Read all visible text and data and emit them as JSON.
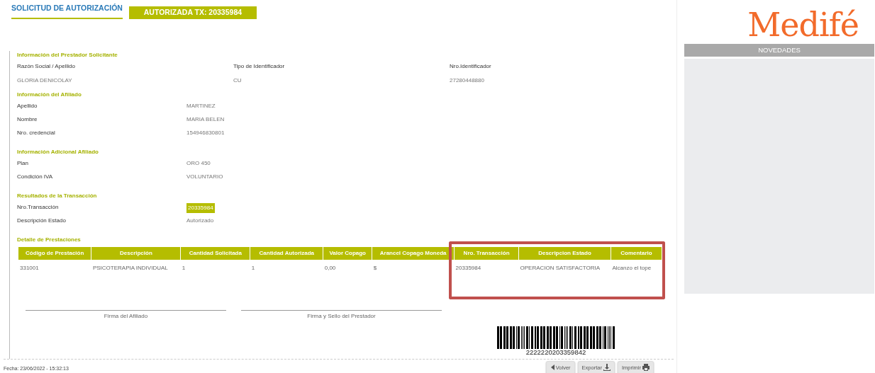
{
  "header": {
    "tab": {
      "label": "SOLICITUD DE AUTORIZACIÓN",
      "selected": true
    },
    "status_badge": "AUTORIZADA TX: 20335984"
  },
  "sections": [
    {
      "title": "Información del Prestador Solicitante",
      "kind": "columns",
      "fields": [
        {
          "label": "Razón Social / Apellido",
          "value": "GLORIA DENICOLAY"
        },
        {
          "label": "Tipo de Identificador",
          "value": "CU"
        },
        {
          "label": "Nro.Identificador",
          "value": "27280448880"
        }
      ]
    },
    {
      "title": "Información del Afiliado",
      "kind": "rows",
      "fields": [
        {
          "label": "Apellido",
          "value": "MARTINEZ"
        },
        {
          "label": "Nombre",
          "value": "MARIA BELEN"
        },
        {
          "label": "Nro. credencial",
          "value": "154946830801"
        }
      ]
    },
    {
      "title": "Información Adicional Afiliado",
      "kind": "rows",
      "fields": [
        {
          "label": "Plan",
          "value": "ORO 450"
        },
        {
          "label": "Condición IVA",
          "value": "VOLUNTARIO"
        }
      ]
    },
    {
      "title": "Resultados de la Transacción",
      "kind": "rows",
      "fields": [
        {
          "label": "Nro.Transacción",
          "value": "20335984",
          "highlighted": true
        },
        {
          "label": "Descripción Estado",
          "value": "Autorizado",
          "highlighted": false
        }
      ]
    }
  ],
  "table": {
    "title": "Detalle de Prestaciones",
    "columns": [
      {
        "label": "Código de Prestación",
        "highlighted": false
      },
      {
        "label": "Descripción",
        "highlighted": false
      },
      {
        "label": "Cantidad Solicitada",
        "highlighted": false
      },
      {
        "label": "Cantidad Autorizada",
        "highlighted": false
      },
      {
        "label": "Valor Copago",
        "highlighted": false
      },
      {
        "label": "Arancel Copago Moneda",
        "highlighted": false
      },
      {
        "label": "Nro. Transacción",
        "highlighted": true
      },
      {
        "label": "Descripcion Estado",
        "highlighted": true
      },
      {
        "label": "Comentario",
        "highlighted": true
      }
    ],
    "rows": [
      [
        "331001",
        "PSICOTERAPIA INDIVIDUAL",
        "1",
        "1",
        "0,00",
        "$",
        "20335984",
        "OPERACION SATISFACTORIA",
        "Alcanzo el tope"
      ]
    ]
  },
  "signatures": [
    "Firma del Afiliado",
    "Firma y Sello del Prestador"
  ],
  "barcode": "2222220203359842",
  "footer": {
    "date": "Fecha: 23/06/2022 - 15:32:13",
    "buttons": [
      {
        "label": "Volver"
      },
      {
        "label": "Exportar"
      },
      {
        "label": "Imprimir"
      }
    ]
  },
  "sidebar": {
    "logo": "Medifé",
    "panel_title": "NOVEDADES"
  }
}
